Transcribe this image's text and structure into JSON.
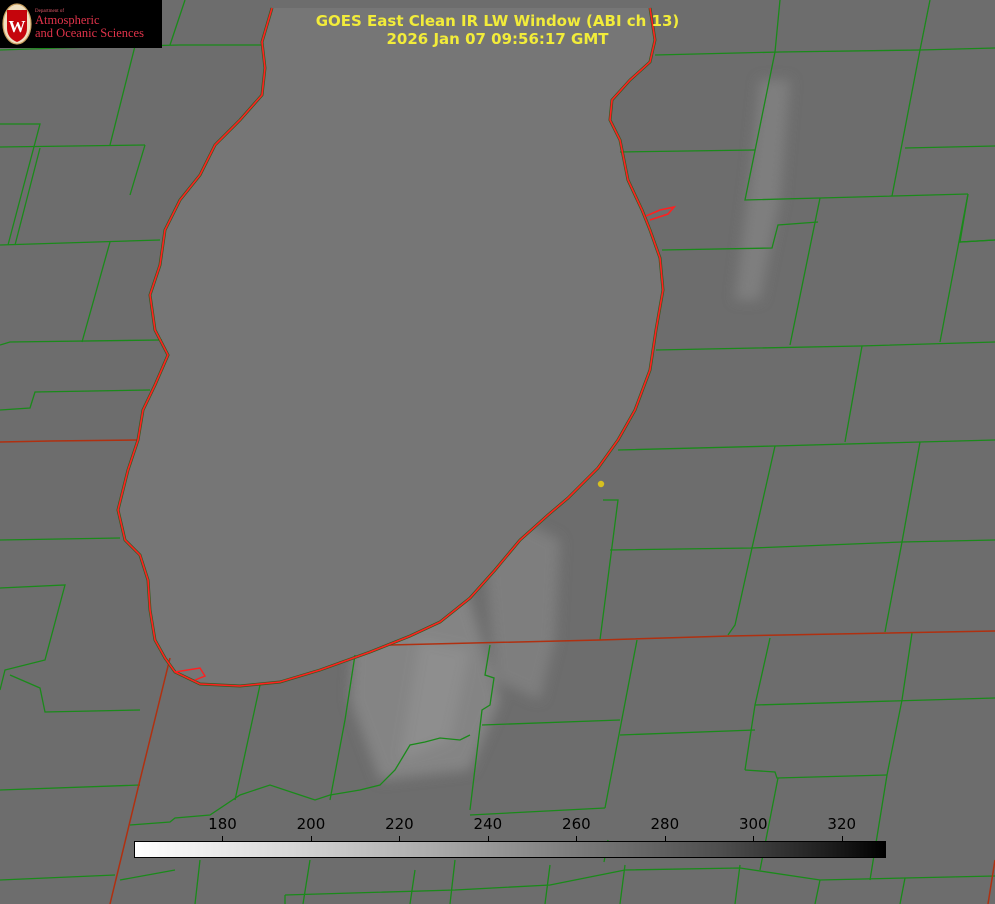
{
  "logo": {
    "department": "Department of",
    "line1": "Atmospheric",
    "line2": "and Oceanic Sciences",
    "seal_letter": "W"
  },
  "title": {
    "line1": "GOES East Clean IR LW Window (ABI ch 13)",
    "line2": "2026 Jan 07 09:56:17 GMT"
  },
  "colorbar": {
    "min": 160,
    "max": 330,
    "ticks": [
      "180",
      "200",
      "220",
      "240",
      "260",
      "280",
      "300",
      "320"
    ]
  },
  "colors": {
    "background": "#6e6e6e",
    "lake": "#767676",
    "county_lines": "#1a8a1a",
    "state_lines": "#b03010",
    "shoreline": "#ff2020",
    "title_text": "#f2ec3a",
    "logo_text": "#e0334a",
    "marker": "#d6c020"
  },
  "marker": {
    "name": "location-dot-icon"
  }
}
